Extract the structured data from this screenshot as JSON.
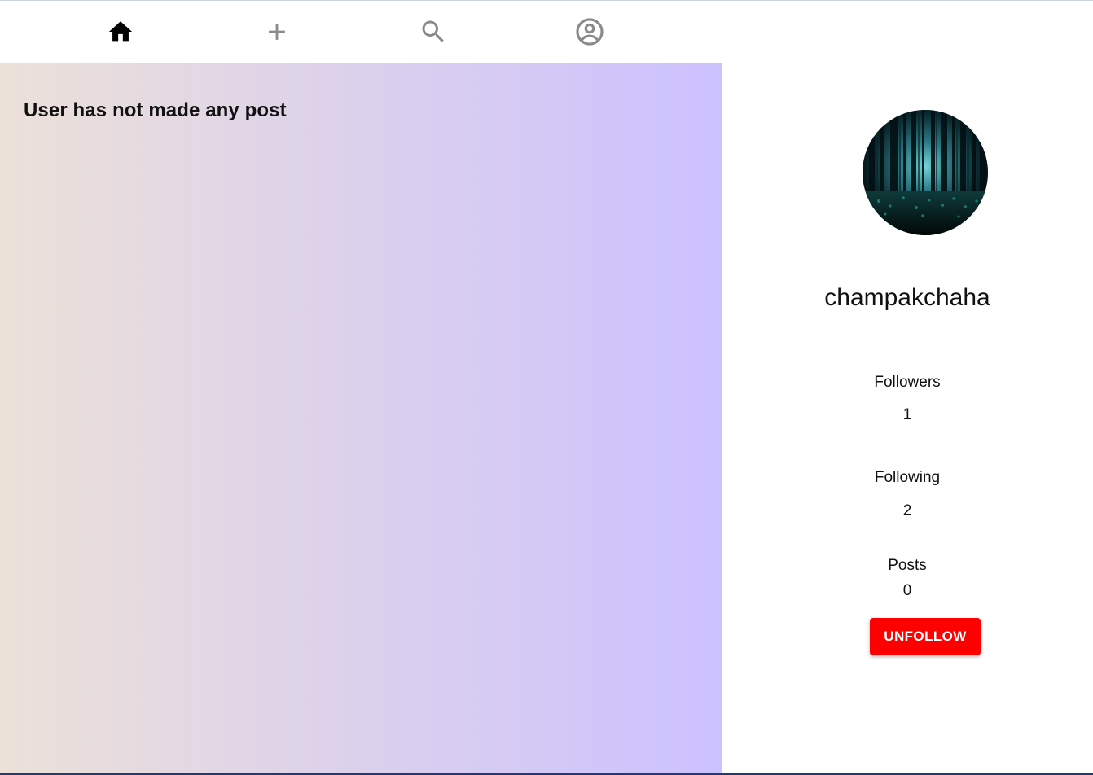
{
  "nav": {
    "items": [
      {
        "name": "home",
        "icon": "home-icon",
        "active": true
      },
      {
        "name": "add",
        "icon": "plus-icon",
        "active": false
      },
      {
        "name": "search",
        "icon": "search-icon",
        "active": false
      },
      {
        "name": "account",
        "icon": "account-circle-icon",
        "active": false
      }
    ],
    "active_color": "#000000",
    "inactive_color": "#8a8a8a"
  },
  "posts": {
    "empty_message": "User has not made any post"
  },
  "profile": {
    "username": "champakchaha",
    "avatar_icon": "forest-avatar-image",
    "stats": {
      "followers_label": "Followers",
      "followers_value": "1",
      "following_label": "Following",
      "following_value": "2",
      "posts_label": "Posts",
      "posts_value": "0"
    },
    "unfollow_label": "UNFOLLOW",
    "unfollow_color": "#ff0000"
  }
}
